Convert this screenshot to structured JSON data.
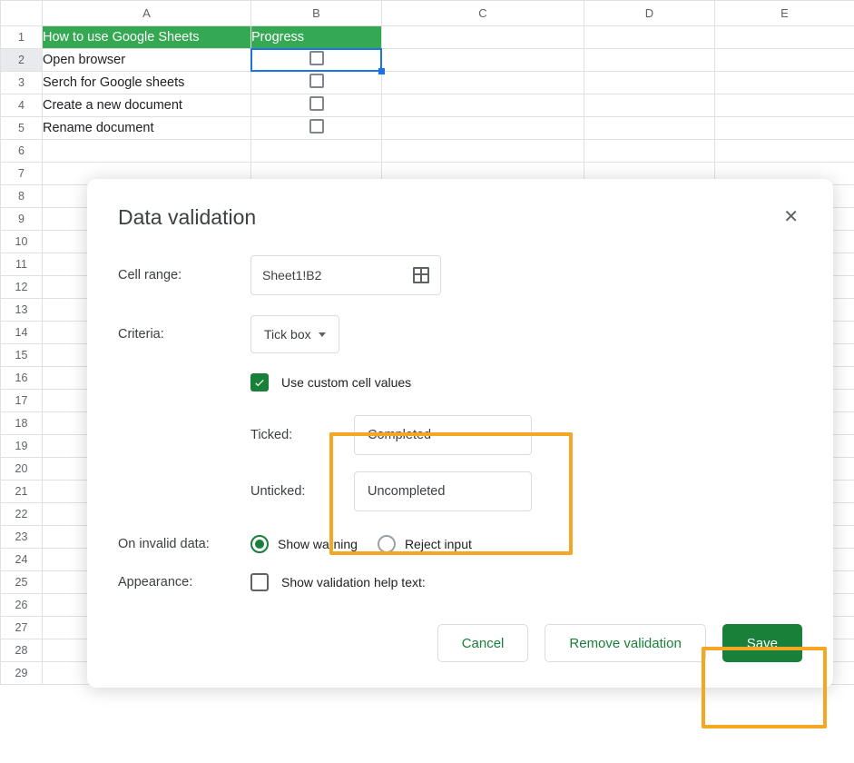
{
  "columns": [
    "A",
    "B",
    "C",
    "D",
    "E"
  ],
  "rows": [
    "1",
    "2",
    "3",
    "4",
    "5",
    "6",
    "7",
    "8",
    "9",
    "10",
    "11",
    "12",
    "13",
    "14",
    "15",
    "16",
    "17",
    "18",
    "19",
    "20",
    "21",
    "22",
    "23",
    "24",
    "25",
    "26",
    "27",
    "28",
    "29"
  ],
  "header": {
    "a": "How to use Google Sheets",
    "b": "Progress"
  },
  "data": [
    "Open browser",
    "Serch for Google sheets",
    "Create a new document",
    "Rename document"
  ],
  "dialog": {
    "title": "Data validation",
    "labels": {
      "cell_range": "Cell range:",
      "criteria": "Criteria:",
      "use_custom": "Use custom cell values",
      "ticked": "Ticked:",
      "unticked": "Unticked:",
      "invalid": "On invalid data:",
      "show_warning": "Show warning",
      "reject": "Reject input",
      "appearance": "Appearance:",
      "helptext": "Show validation help text:"
    },
    "range_value": "Sheet1!B2",
    "criteria_value": "Tick box",
    "ticked_value": "Completed",
    "unticked_value": "Uncompleted",
    "buttons": {
      "cancel": "Cancel",
      "remove": "Remove validation",
      "save": "Save"
    }
  }
}
